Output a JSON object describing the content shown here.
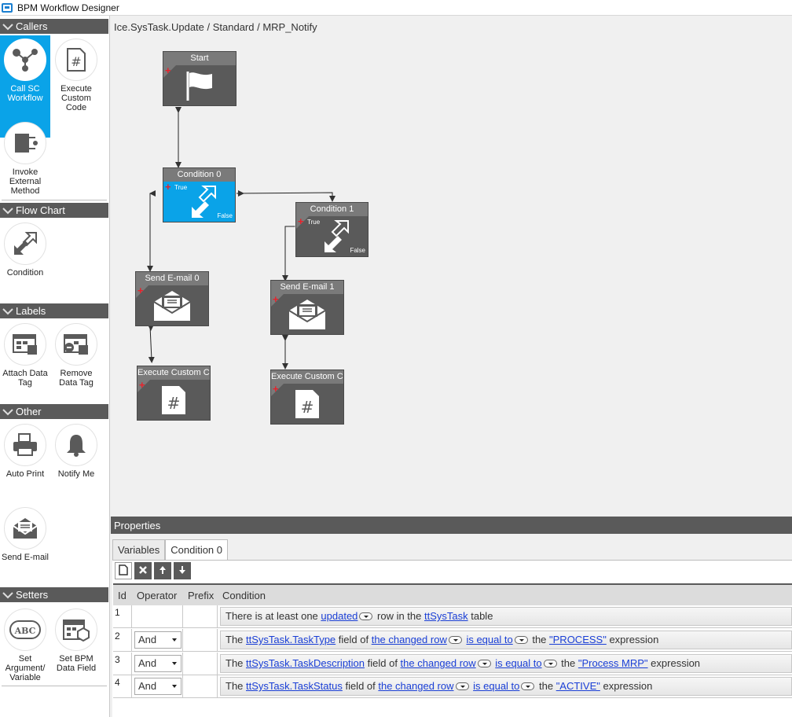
{
  "window": {
    "title": "BPM Workflow Designer"
  },
  "sidebar": {
    "sections": [
      {
        "label": "Callers"
      },
      {
        "label": "Flow Chart"
      },
      {
        "label": "Labels"
      },
      {
        "label": "Other"
      },
      {
        "label": "Setters"
      }
    ],
    "tools": {
      "call_sc_workflow": "Call SC Workflow",
      "execute_custom_code": "Execute Custom Code",
      "invoke_external_method": "Invoke External Method",
      "condition": "Condition",
      "attach_data_tag": "Attach Data Tag",
      "remove_data_tag": "Remove Data Tag",
      "auto_print": "Auto Print",
      "notify_me": "Notify Me",
      "send_email": "Send E-mail",
      "set_argument_variable": "Set Argument/ Variable",
      "set_bpm_data_field": "Set BPM Data Field"
    }
  },
  "canvas": {
    "breadcrumb": "Ice.SysTask.Update / Standard / MRP_Notify",
    "nodes": {
      "start": "Start",
      "condition0": "Condition 0",
      "condition1": "Condition 1",
      "send_email0": "Send E-mail 0",
      "send_email1": "Send E-mail 1",
      "execute0": "Execute Custom Code",
      "execute1": "Execute Custom Code"
    },
    "true_label": "True",
    "false_label": "False"
  },
  "properties": {
    "header": "Properties",
    "tabs": [
      "Variables",
      "Condition 0"
    ],
    "active_tab": "Condition 0",
    "columns": {
      "id": "Id",
      "operator": "Operator",
      "prefix": "Prefix",
      "condition": "Condition"
    },
    "rows": [
      {
        "id": "1",
        "operator": "",
        "parts": {
          "a": "There is at least one ",
          "b": "updated",
          "c": " row in the ",
          "d": "ttSysTask",
          "e": " table"
        }
      },
      {
        "id": "2",
        "operator": "And",
        "parts": {
          "a": "The ",
          "field": "ttSysTask.TaskType",
          "b": " field of ",
          "row": "the changed row",
          "op": "is equal to",
          "c": " the ",
          "val": "\"PROCESS\"",
          "d": " expression"
        }
      },
      {
        "id": "3",
        "operator": "And",
        "parts": {
          "a": "The ",
          "field": "ttSysTask.TaskDescription",
          "b": " field of ",
          "row": "the changed row",
          "op": "is equal to",
          "c": " the ",
          "val": "\"Process MRP\"",
          "d": " expression"
        }
      },
      {
        "id": "4",
        "operator": "And",
        "parts": {
          "a": "The ",
          "field": "ttSysTask.TaskStatus",
          "b": " field of ",
          "row": "the changed row",
          "op": "is equal to",
          "c": " the ",
          "val": "\"ACTIVE\"",
          "d": " expression"
        }
      }
    ]
  },
  "colors": {
    "accent": "#0aa3e8",
    "header": "#5a5a5a",
    "link": "#1a3fd6",
    "plus": "#e8202a"
  }
}
